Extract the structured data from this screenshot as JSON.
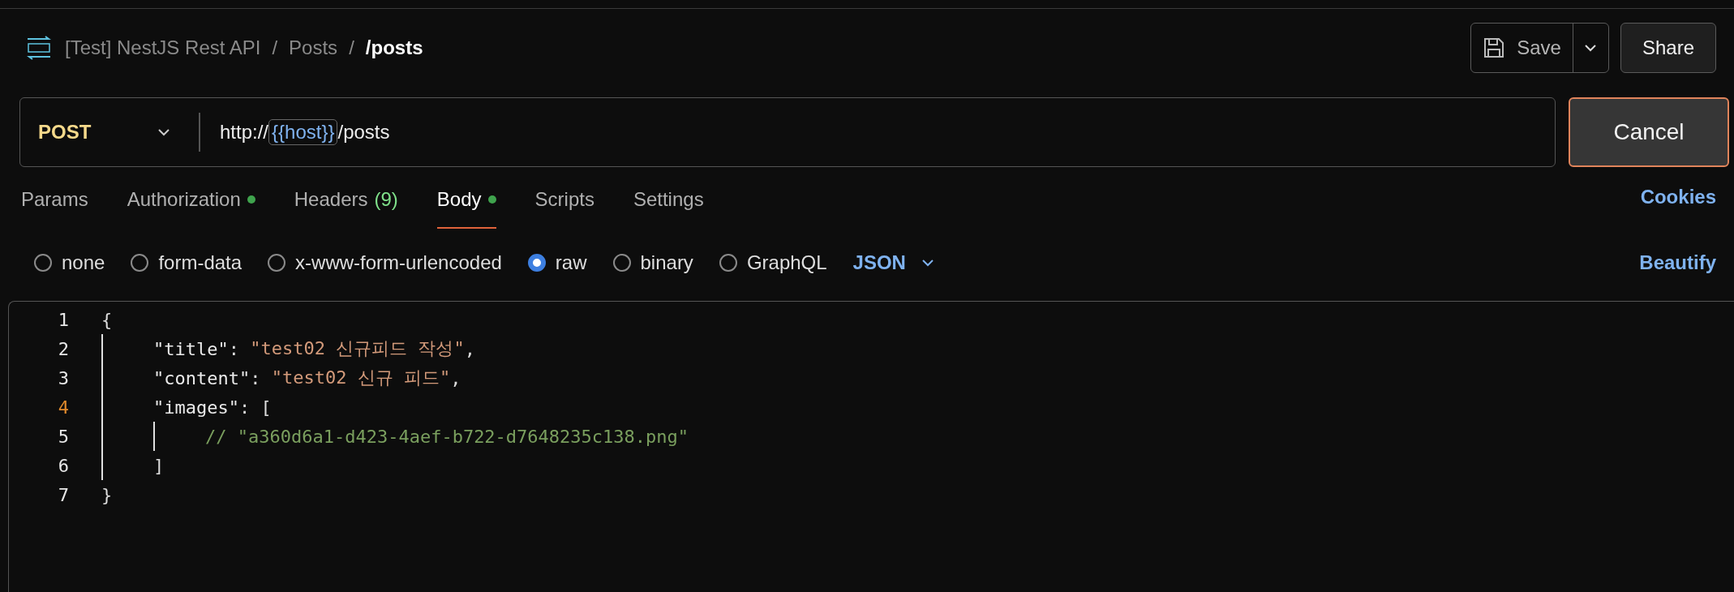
{
  "breadcrumb": [
    {
      "text": "[Test] NestJS Rest API",
      "current": false
    },
    {
      "text": "Posts",
      "current": false
    },
    {
      "text": "/posts",
      "current": true
    }
  ],
  "breadcrumb_separator": "/",
  "save_button": {
    "label": "Save"
  },
  "share_button": {
    "label": "Share"
  },
  "request": {
    "method": "POST",
    "url_parts": [
      {
        "kind": "plain",
        "text": "http://"
      },
      {
        "kind": "variable",
        "text": "{{host}}"
      },
      {
        "kind": "plain",
        "text": "/posts"
      }
    ]
  },
  "cancel_button": {
    "label": "Cancel"
  },
  "tabs": [
    {
      "label": "Params",
      "selected": false,
      "dot": false
    },
    {
      "label": "Authorization",
      "selected": false,
      "dot": true
    },
    {
      "label": "Headers",
      "count": "(9)",
      "selected": false,
      "dot": false
    },
    {
      "label": "Body",
      "selected": true,
      "dot": true
    },
    {
      "label": "Scripts",
      "selected": false,
      "dot": false
    },
    {
      "label": "Settings",
      "selected": false,
      "dot": false
    }
  ],
  "cookies_link": "Cookies",
  "body_types": [
    {
      "label": "none",
      "selected": false
    },
    {
      "label": "form-data",
      "selected": false
    },
    {
      "label": "x-www-form-urlencoded",
      "selected": false
    },
    {
      "label": "raw",
      "selected": true
    },
    {
      "label": "binary",
      "selected": false
    },
    {
      "label": "GraphQL",
      "selected": false
    }
  ],
  "format": "JSON",
  "beautify_link": "Beautify",
  "editor": {
    "lines": [
      {
        "number": "1",
        "active": false,
        "tokens": [
          {
            "kind": "punct",
            "text": "{"
          }
        ],
        "children": [
          {
            "number": "2",
            "active": false,
            "tokens": [
              {
                "kind": "key",
                "text": "\"title\""
              },
              {
                "kind": "punct",
                "text": ": "
              },
              {
                "kind": "string",
                "text": "\"test02 신규피드 작성\""
              },
              {
                "kind": "punct",
                "text": ","
              }
            ]
          },
          {
            "number": "3",
            "active": false,
            "tokens": [
              {
                "kind": "key",
                "text": "\"content\""
              },
              {
                "kind": "punct",
                "text": ": "
              },
              {
                "kind": "string",
                "text": "\"test02 신규 피드\""
              },
              {
                "kind": "punct",
                "text": ","
              }
            ]
          },
          {
            "number": "4",
            "active": true,
            "tokens": [
              {
                "kind": "key",
                "text": "\"images\""
              },
              {
                "kind": "punct",
                "text": ": ["
              }
            ],
            "children": [
              {
                "number": "5",
                "active": false,
                "tokens": [
                  {
                    "kind": "comment",
                    "text": "// \"a360d6a1-d423-4aef-b722-d7648235c138.png\""
                  }
                ]
              }
            ]
          },
          {
            "number": "6",
            "active": false,
            "tokens": [
              {
                "kind": "punct",
                "text": "]"
              }
            ]
          }
        ]
      },
      {
        "number": "7",
        "active": false,
        "tokens": [
          {
            "kind": "punct",
            "text": "}"
          }
        ]
      }
    ]
  }
}
